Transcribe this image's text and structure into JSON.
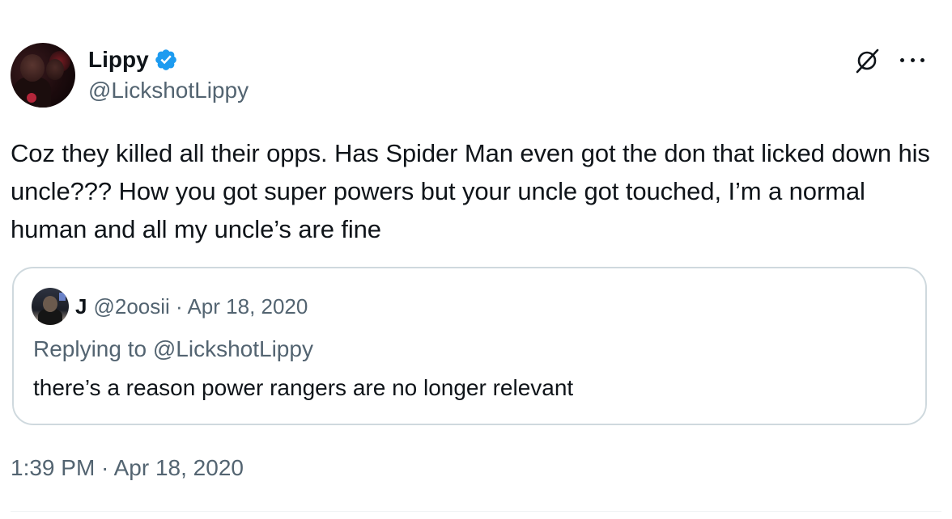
{
  "author": {
    "display_name": "Lippy",
    "handle": "@LickshotLippy",
    "verified": true
  },
  "tweet": {
    "text": "Coz they killed all their opps. Has Spider Man even got the don that licked down his uncle??? How you got super powers but your uncle got touched, I’m a normal human and all my uncle’s are fine",
    "timestamp": "1:39 PM · Apr 18, 2020"
  },
  "quote": {
    "display_name": "J",
    "meta": "@2oosii · Apr 18, 2020",
    "replying_to": "Replying to @LickshotLippy",
    "text": "there’s a reason power rangers are no longer relevant"
  },
  "icons": {
    "verified": "verified-badge-icon",
    "grok": "grok-icon",
    "more": "more-icon"
  },
  "colors": {
    "primary_text": "#0f1419",
    "secondary_text": "#536471",
    "verified_blue": "#1d9bf0",
    "border": "#cfd9de"
  }
}
